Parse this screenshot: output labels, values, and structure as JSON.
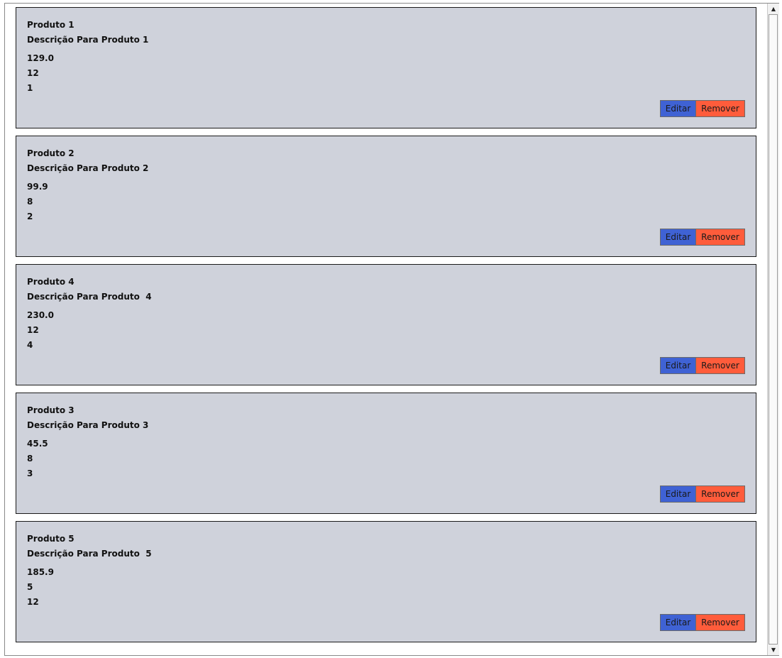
{
  "products": [
    {
      "name": "Produto 1",
      "description": "Descrição Para Produto 1",
      "price": "129.0",
      "quantity": "12",
      "code": "1",
      "edit_label": "Editar",
      "remove_label": "Remover"
    },
    {
      "name": "Produto 2",
      "description": "Descrição Para Produto 2",
      "price": "99.9",
      "quantity": "8",
      "code": "2",
      "edit_label": "Editar",
      "remove_label": "Remover"
    },
    {
      "name": "Produto 4",
      "description": "Descrição Para Produto  4",
      "price": "230.0",
      "quantity": "12",
      "code": "4",
      "edit_label": "Editar",
      "remove_label": "Remover"
    },
    {
      "name": "Produto 3",
      "description": "Descrição Para Produto 3",
      "price": "45.5",
      "quantity": "8",
      "code": "3",
      "edit_label": "Editar",
      "remove_label": "Remover"
    },
    {
      "name": "Produto 5",
      "description": "Descrição Para Produto  5",
      "price": "185.9",
      "quantity": "5",
      "code": "12",
      "edit_label": "Editar",
      "remove_label": "Remover"
    }
  ],
  "scrollbar": {
    "up_icon": "arrow-up-icon",
    "down_icon": "arrow-down-icon"
  },
  "colors": {
    "card_background": "#cfd2db",
    "edit_button": "#3f62d4",
    "remove_button": "#ff5c3b"
  }
}
